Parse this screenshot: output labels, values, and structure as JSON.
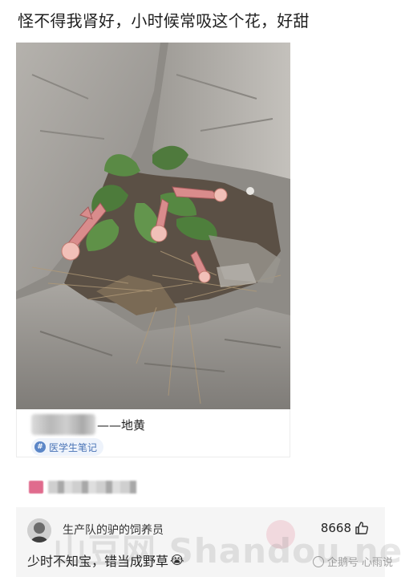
{
  "post": {
    "text": "怪不得我肾好，小时候常吸这个花，好甜"
  },
  "photo": {
    "alt": "花"
  },
  "caption_card": {
    "caption_suffix": "——地黄",
    "tag_label": "医学生笔记",
    "tag_icon": "tag-icon"
  },
  "comment": {
    "username": "生产队的驴的饲养员",
    "likes": "8668",
    "text": "少时不知宝，错当成野草",
    "emoji": "😭"
  },
  "watermark": {
    "main": "山豆网 Shandou.net",
    "sub": "企鹅号 心雨说"
  },
  "colors": {
    "tag_bg": "#eef3fb",
    "tag_text": "#4a74b6",
    "comment_bg": "#f5f5f5",
    "flower": "#d98c8c"
  }
}
